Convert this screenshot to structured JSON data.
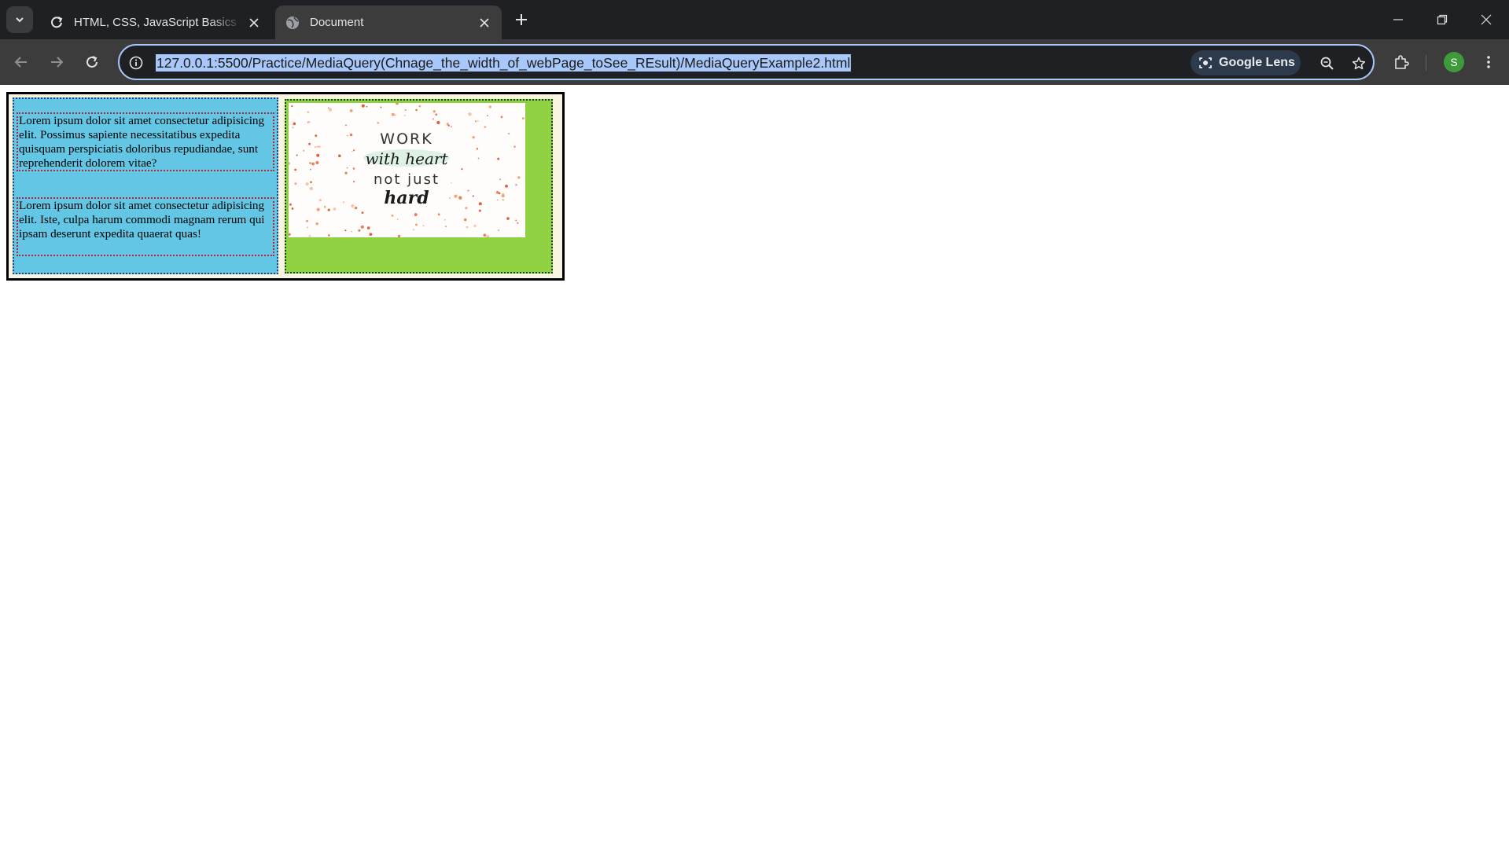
{
  "browser": {
    "tabs": [
      {
        "title": "HTML, CSS, JavaScript Basics - C",
        "icon": "refresh-loop-icon",
        "active": false
      },
      {
        "title": "Document",
        "icon": "globe-icon",
        "active": true
      }
    ],
    "address_bar": {
      "url": "127.0.0.1:5500/Practice/MediaQuery(Chnage_the_width_of_webPage_toSee_REsult)/MediaQueryExample2.html",
      "lens_label": "Google Lens"
    },
    "profile_initial": "S",
    "colors": {
      "frame": "#1f2023",
      "toolbar": "#3c3c3c",
      "url_highlight": "#a8c7fa",
      "avatar": "#3f9b3a"
    }
  },
  "page": {
    "paragraphs": [
      "Lorem ipsum dolor sit amet consectetur adipisicing elit. Possimus sapiente necessitatibus expedita quisquam perspiciatis doloribus repudiandae, sunt reprehenderit dolorem vitae?",
      "Lorem ipsum dolor sit amet consectetur adipisicing elit. Iste, culpa harum commodi magnam rerum qui ipsam deserunt expedita quaerat quas!"
    ],
    "image_text": {
      "line1": "WORK",
      "line2": "with heart",
      "line3": "not just",
      "line4": "hard"
    },
    "colors": {
      "left_column": "#62c6e4",
      "right_column": "#8fd141",
      "container": "#f7f4e0"
    }
  }
}
